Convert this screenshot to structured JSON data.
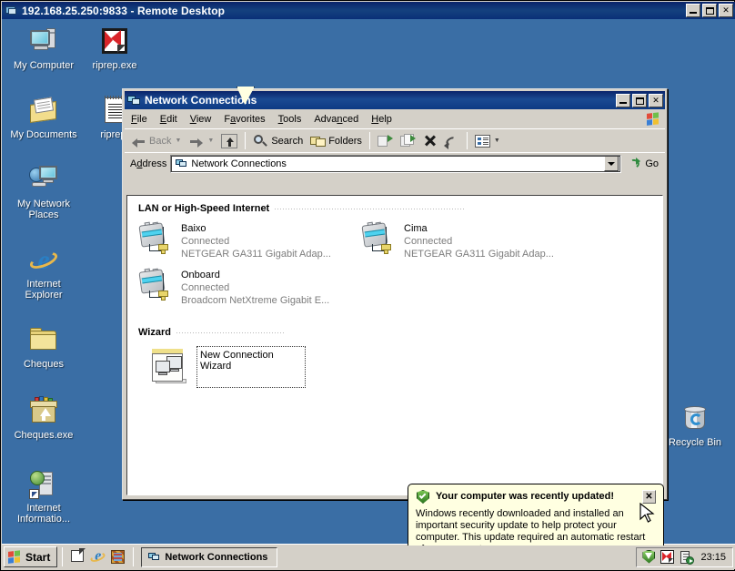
{
  "rdp": {
    "title": "192.168.25.250:9833 - Remote Desktop",
    "minimize": "_",
    "restore": "❐",
    "close": "✕"
  },
  "desktop": {
    "background_color": "#3a6ea5",
    "icons": [
      {
        "name": "My Computer",
        "icon": "my-computer-icon"
      },
      {
        "name": "riprep.exe",
        "icon": "riprep-exe-icon"
      },
      {
        "name": "My Documents",
        "icon": "my-documents-icon"
      },
      {
        "name": "riprep.",
        "icon": "riprep-text-icon"
      },
      {
        "name": "My Network\nPlaces",
        "icon": "my-network-places-icon"
      },
      {
        "name": "Internet\nExplorer",
        "icon": "internet-explorer-icon"
      },
      {
        "name": "Cheques",
        "icon": "folder-icon"
      },
      {
        "name": "Cheques.exe",
        "icon": "setup-package-icon"
      },
      {
        "name": "Internet\nInformatio...",
        "icon": "iis-manager-icon"
      },
      {
        "name": "Recycle Bin",
        "icon": "recycle-bin-icon"
      }
    ]
  },
  "explorer": {
    "title": "Network Connections",
    "window_buttons": {
      "minimize": "_",
      "maximize": "❐",
      "close": "✕"
    },
    "menus": [
      "File",
      "Edit",
      "View",
      "Favorites",
      "Tools",
      "Advanced",
      "Help"
    ],
    "toolbar": {
      "back": "Back",
      "forward": "",
      "up": "",
      "search": "Search",
      "folders": "Folders",
      "move_to": "",
      "copy_to": "",
      "delete": "",
      "undo": "",
      "views": ""
    },
    "address": {
      "label": "Address",
      "value": "Network Connections",
      "go_label": "Go"
    },
    "groups": [
      {
        "title": "LAN or High-Speed Internet",
        "items": [
          {
            "name": "Baixo",
            "status": "Connected",
            "device": "NETGEAR GA311 Gigabit Adap..."
          },
          {
            "name": "Cima",
            "status": "Connected",
            "device": "NETGEAR GA311 Gigabit Adap..."
          },
          {
            "name": "Onboard",
            "status": "Connected",
            "device": "Broadcom NetXtreme Gigabit E..."
          }
        ]
      },
      {
        "title": "Wizard",
        "items": [
          {
            "name": "New Connection Wizard",
            "status": "",
            "device": ""
          }
        ]
      }
    ]
  },
  "balloon": {
    "title": "Your computer was recently updated!",
    "body": "Windows recently downloaded and installed an important security update to help protect your computer. This update required an automatic restart of your computer.",
    "close_label": "✕"
  },
  "taskbar": {
    "start_label": "Start",
    "quicklaunch": [
      "show-desktop-icon",
      "internet-explorer-icon",
      "windows-media-player-icon"
    ],
    "tasks": [
      {
        "label": "Network Connections",
        "icon": "network-connections-icon",
        "active": true
      }
    ],
    "tray": {
      "icons": [
        "security-shield-icon",
        "kaspersky-icon",
        "network-activity-icon"
      ],
      "clock": "23:15"
    }
  }
}
